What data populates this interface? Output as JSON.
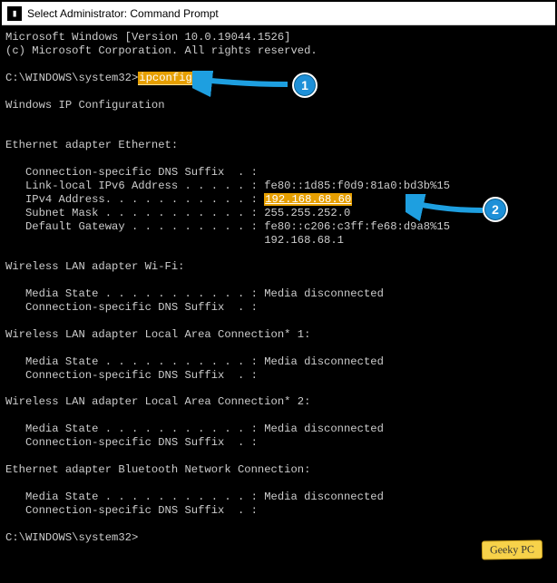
{
  "titlebar": {
    "icon": "cmd-icon",
    "text": "Select Administrator: Command Prompt"
  },
  "header": {
    "line1": "Microsoft Windows [Version 10.0.19044.1526]",
    "line2": "(c) Microsoft Corporation. All rights reserved."
  },
  "prompt1": {
    "prefix": "C:\\WINDOWS\\system32>",
    "command": "ipconfig"
  },
  "config_header": "Windows IP Configuration",
  "ethernet": {
    "title": "Ethernet adapter Ethernet:",
    "dns_suffix_label": "   Connection-specific DNS Suffix  . :",
    "ipv6_label": "   Link-local IPv6 Address . . . . . : ",
    "ipv6_value": "fe80::1d85:f0d9:81a0:bd3b%15",
    "ipv4_label": "   IPv4 Address. . . . . . . . . . . : ",
    "ipv4_value": "192.168.68.60",
    "mask_label": "   Subnet Mask . . . . . . . . . . . : ",
    "mask_value": "255.255.252.0",
    "gw_label": "   Default Gateway . . . . . . . . . : ",
    "gw_value1": "fe80::c206:c3ff:fe68:d9a8%15",
    "gw_value2_indent": "                                       ",
    "gw_value2": "192.168.68.1"
  },
  "wifi": {
    "title": "Wireless LAN adapter Wi-Fi:",
    "media_label": "   Media State . . . . . . . . . . . : ",
    "media_value": "Media disconnected",
    "dns_label": "   Connection-specific DNS Suffix  . :"
  },
  "lac1": {
    "title": "Wireless LAN adapter Local Area Connection* 1:",
    "media_label": "   Media State . . . . . . . . . . . : ",
    "media_value": "Media disconnected",
    "dns_label": "   Connection-specific DNS Suffix  . :"
  },
  "lac2": {
    "title": "Wireless LAN adapter Local Area Connection* 2:",
    "media_label": "   Media State . . . . . . . . . . . : ",
    "media_value": "Media disconnected",
    "dns_label": "   Connection-specific DNS Suffix  . :"
  },
  "bt": {
    "title": "Ethernet adapter Bluetooth Network Connection:",
    "media_label": "   Media State . . . . . . . . . . . : ",
    "media_value": "Media disconnected",
    "dns_label": "   Connection-specific DNS Suffix  . :"
  },
  "prompt2": "C:\\WINDOWS\\system32>",
  "annotations": {
    "badge1": "1",
    "badge2": "2",
    "arrow_color": "#1e9fe0"
  },
  "watermark": "Geeky PC"
}
